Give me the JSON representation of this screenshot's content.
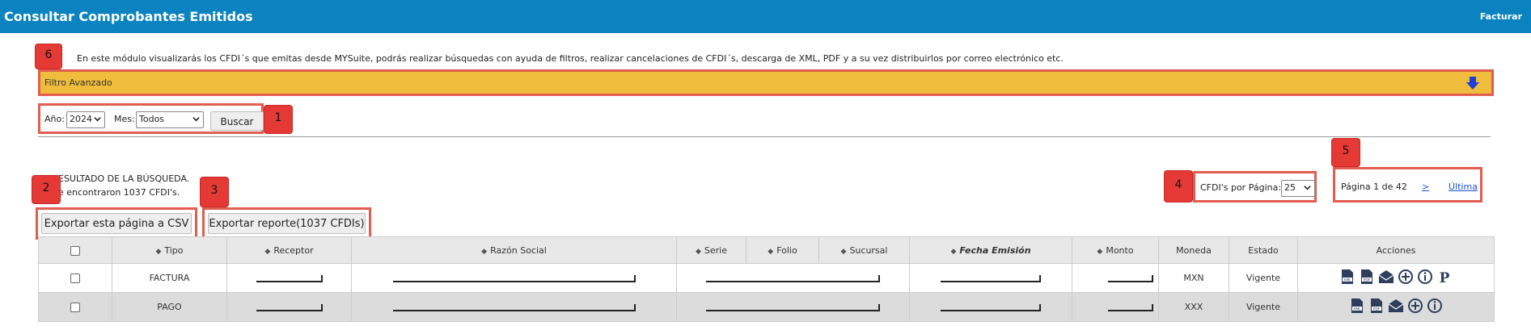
{
  "header": {
    "title": "Consultar Comprobantes Emitidos",
    "action": "Facturar"
  },
  "description": "En este módulo visualizarás los CFDI´s que emitas desde MYSuite, podrás realizar búsquedas con ayuda de filtros, realizar cancelaciones de CFDI´s, descarga de XML, PDF y a su vez distribuirlos por correo electrónico etc.",
  "filter": {
    "label": "Filtro Avanzado",
    "icon": "down-arrow-icon"
  },
  "search": {
    "year_label": "Año:",
    "year_value": "2024",
    "month_label": "Mes:",
    "month_value": "Todos",
    "button": "Buscar"
  },
  "results": {
    "title": "ESULTADO DE LA BÚSQUEDA.",
    "count_text": "e encontraron 1037 CFDI's."
  },
  "export": {
    "csv": "Exportar esta página a CSV",
    "report": "Exportar reporte(1037 CFDIs)"
  },
  "perpage": {
    "label": "CFDI's por Página:",
    "value": "25"
  },
  "pager": {
    "text": "Página 1 de 42",
    "next": ">",
    "last": "Última"
  },
  "callouts": [
    "1",
    "2",
    "3",
    "4",
    "5",
    "6"
  ],
  "table": {
    "headers": [
      "",
      "Tipo",
      "Receptor",
      "Razón Social",
      "Serie",
      "Folio",
      "Sucursal",
      "Fecha Emisión",
      "Monto",
      "Moneda",
      "Estado",
      "Acciones"
    ],
    "rows": [
      {
        "tipo": "FACTURA",
        "moneda": "MXN",
        "estado": "Vigente",
        "actions": [
          "xml-icon",
          "pdf-icon",
          "mail-icon",
          "plus-icon",
          "info-icon",
          "p-icon"
        ]
      },
      {
        "tipo": "PAGO",
        "moneda": "XXX",
        "estado": "Vigente",
        "actions": [
          "xml-icon",
          "pdf-icon",
          "mail-icon",
          "plus-icon",
          "info-icon"
        ]
      }
    ]
  },
  "colors": {
    "header_bg": "#0a83c0",
    "filter_bg": "#efbd3b",
    "callout_red": "#e53935"
  }
}
